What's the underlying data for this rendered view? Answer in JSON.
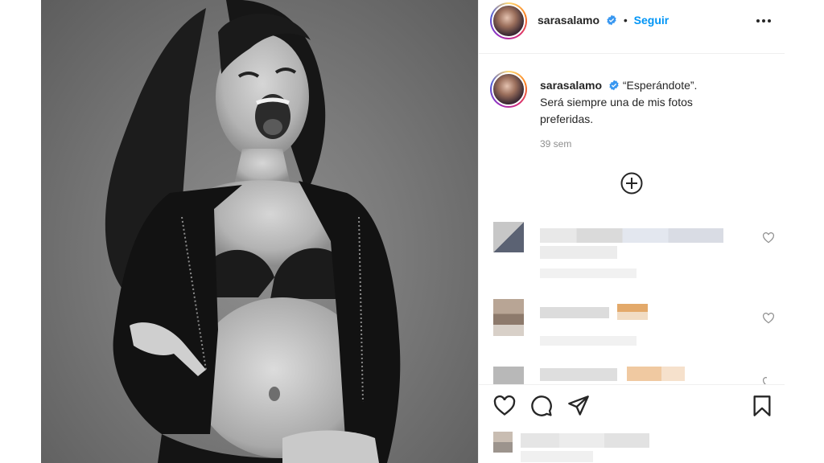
{
  "post": {
    "username": "sarasalamo",
    "follow_label": "Seguir",
    "caption_line1": "“Esperándote”.",
    "caption_line2": "Será siempre una de mis fotos",
    "caption_line3": "preferidas.",
    "time_ago": "39 sem"
  },
  "colors": {
    "accent": "#0095f6",
    "text": "#262626",
    "muted": "#8e8e8e",
    "border": "#efefef"
  },
  "icons": [
    "verified-badge-icon",
    "more-options-icon",
    "load-more-comments-icon",
    "like-icon",
    "comment-icon",
    "share-icon",
    "save-icon",
    "comment-like-icon"
  ]
}
